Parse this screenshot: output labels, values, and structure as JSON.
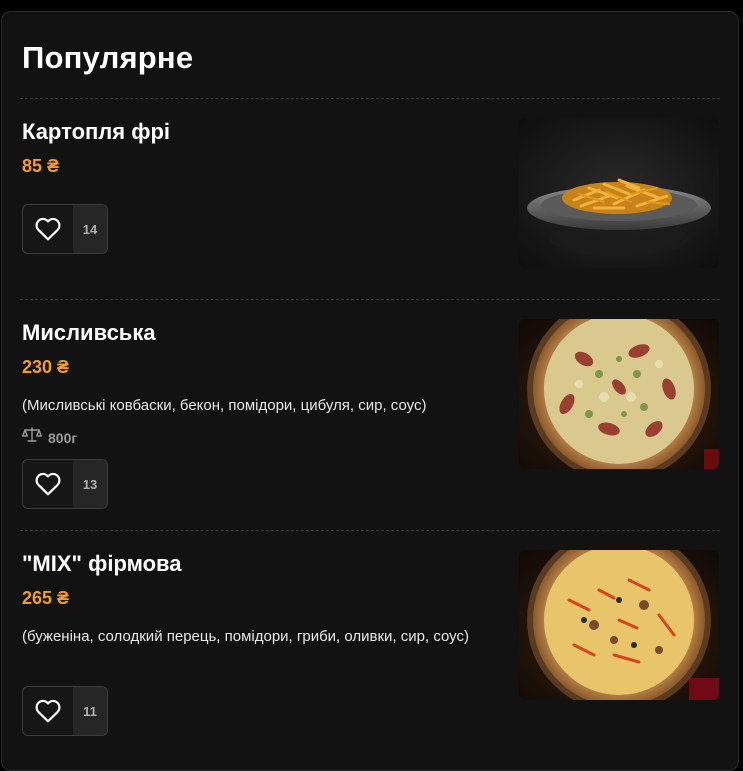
{
  "section": {
    "title": "Популярне"
  },
  "items": [
    {
      "name": "Картопля фрі",
      "price": "85 ₴",
      "description": "",
      "weight": "",
      "likes": "14",
      "image_icon": "fries-photo"
    },
    {
      "name": "Мисливська",
      "price": "230 ₴",
      "description": "(Мисливські ковбаски, бекон, помідори, цибуля, сир, соус)",
      "weight": "800г",
      "likes": "13",
      "image_icon": "pizza-photo"
    },
    {
      "name": "\"MIX\" фірмова",
      "price": "265 ₴",
      "description": "(буженіна, солодкий перець, помідори, гриби, оливки, сир, соус)",
      "weight": "",
      "likes": "11",
      "image_icon": "pizza-photo"
    }
  ],
  "colors": {
    "background": "#121212",
    "price": "#f39c2a",
    "text": "#ffffff",
    "muted": "#9a9a9a"
  }
}
